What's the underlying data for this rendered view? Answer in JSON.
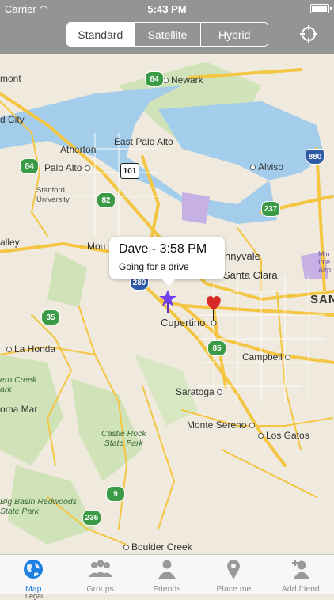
{
  "status_bar": {
    "carrier": "Carrier",
    "time": "5:43 PM"
  },
  "map_type": {
    "options": [
      "Standard",
      "Satellite",
      "Hybrid"
    ],
    "selected": "Standard"
  },
  "callout": {
    "title": "Dave - 3:58 PM",
    "subtitle": "Going for a drive"
  },
  "map_labels": {
    "fremont": "mont",
    "newark": "Newark",
    "redwood_city": "d City",
    "atherton": "Atherton",
    "east_palo_alto": "East Palo Alto",
    "palo_alto": "Palo Alto",
    "alviso": "Alviso",
    "stanford": "Stanford\nUniversity",
    "valley": "alley",
    "mountain_view": "Mou",
    "sunnyvale": "nnyvale",
    "santa_clara": "Santa Clara",
    "san_jose": "SAN",
    "mineta": "Min\nInte\nAirp",
    "cupertino": "Cupertino",
    "la_honda": "La Honda",
    "pero_creek": "ero Creek\nark",
    "loma_mar": "oma Mar",
    "campbell": "Campbell",
    "saratoga": "Saratoga",
    "monte_sereno": "Monte Sereno",
    "los_gatos": "Los Gatos",
    "castle_rock": "Castle Rock\nState Park",
    "big_basin": "Big Basin Redwoods\nState Park",
    "boulder_creek": "Boulder Creek",
    "legal": "Legal"
  },
  "shields": {
    "r84a": "84",
    "r84b": "84",
    "r101": "101",
    "r82": "82",
    "r237": "237",
    "i880": "880",
    "i280": "280",
    "r35": "35",
    "r85": "85",
    "r9": "9",
    "r236": "236"
  },
  "tabs": [
    {
      "label": "Map",
      "icon": "globe-icon",
      "active": true
    },
    {
      "label": "Groups",
      "icon": "groups-icon"
    },
    {
      "label": "Friends",
      "icon": "friend-icon"
    },
    {
      "label": "Place me",
      "icon": "pin-icon"
    },
    {
      "label": "Add friend",
      "icon": "add-friend-icon"
    }
  ],
  "colors": {
    "accent": "#1d7fe0",
    "water": "#9ec9ea",
    "park": "#c8deb0",
    "road": "#f5c542",
    "pin": "#d92a2a"
  }
}
